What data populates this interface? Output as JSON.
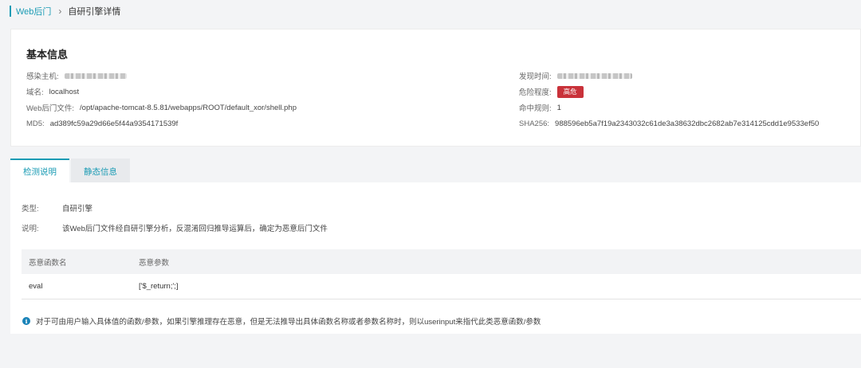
{
  "breadcrumb": {
    "root": "Web后门",
    "separator": "›",
    "current": "自研引擎详情"
  },
  "basic": {
    "title": "基本信息",
    "left": [
      {
        "label": "感染主机:",
        "value": "",
        "redacted": true
      },
      {
        "label": "域名:",
        "value": "localhost"
      },
      {
        "label": "Web后门文件:",
        "value": "/opt/apache-tomcat-8.5.81/webapps/ROOT/default_xor/shell.php"
      },
      {
        "label": "MD5:",
        "value": "ad389fc59a29d66e5f44a9354171539f"
      }
    ],
    "right": [
      {
        "label": "发现时间:",
        "value": "",
        "redacted": true
      },
      {
        "label": "危险程度:",
        "badge": "高危"
      },
      {
        "label": "命中规则:",
        "value": "1"
      },
      {
        "label": "SHA256:",
        "value": "988596eb5a7f19a2343032c61de3a38632dbc2682ab7e314125cdd1e9533ef50"
      }
    ]
  },
  "tabs": [
    {
      "label": "检测说明",
      "active": true
    },
    {
      "label": "静态信息",
      "active": false
    }
  ],
  "detection": {
    "type_label": "类型:",
    "type_value": "自研引擎",
    "desc_label": "说明:",
    "desc_value": "该Web后门文件经自研引擎分析，反混淆回归推导运算后，确定为恶意后门文件"
  },
  "table": {
    "headers": [
      "恶意函数名",
      "恶意参数"
    ],
    "rows": [
      [
        "eval",
        "['$_return;';]"
      ]
    ]
  },
  "note": {
    "icon": "info-icon",
    "text": "对于可由用户输入具体值的函数/参数，如果引擎推理存在恶意，但是无法推导出具体函数名称或者参数名称时，则以userinput来指代此类恶意函数/参数"
  },
  "colors": {
    "accent": "#1a9bb4",
    "danger": "#c9323a",
    "info": "#1a83b8"
  }
}
